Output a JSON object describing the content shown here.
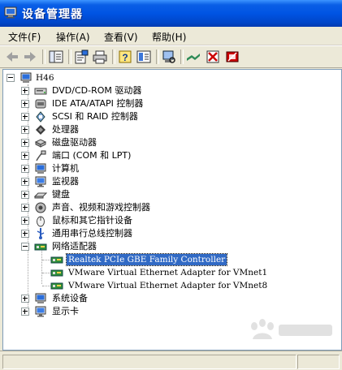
{
  "window": {
    "title": "设备管理器"
  },
  "menu": [
    {
      "label": "文件(F)"
    },
    {
      "label": "操作(A)"
    },
    {
      "label": "查看(V)"
    },
    {
      "label": "帮助(H)"
    }
  ],
  "toolbar": {
    "buttons": [
      "back-arrow-icon",
      "forward-arrow-icon",
      "show-hide-console-tree-icon",
      "properties-icon",
      "print-icon",
      "help-icon",
      "export-list-icon",
      "scan-hardware-icon",
      "update-driver-icon",
      "uninstall-icon",
      "disable-icon"
    ]
  },
  "tree": {
    "root": {
      "label": "H46",
      "icon": "computer-icon",
      "expanded": true
    },
    "items": [
      {
        "label": "DVD/CD-ROM 驱动器",
        "icon": "cdrom-icon",
        "expanded": false
      },
      {
        "label": "IDE ATA/ATAPI 控制器",
        "icon": "ide-controller-icon",
        "expanded": false
      },
      {
        "label": "SCSI 和 RAID 控制器",
        "icon": "scsi-icon",
        "expanded": false
      },
      {
        "label": "处理器",
        "icon": "processor-icon",
        "expanded": false
      },
      {
        "label": "磁盘驱动器",
        "icon": "disk-drive-icon",
        "expanded": false
      },
      {
        "label": "端口 (COM 和 LPT)",
        "icon": "port-icon",
        "expanded": false
      },
      {
        "label": "计算机",
        "icon": "computer-class-icon",
        "expanded": false
      },
      {
        "label": "监视器",
        "icon": "monitor-icon",
        "expanded": false
      },
      {
        "label": "键盘",
        "icon": "keyboard-icon",
        "expanded": false
      },
      {
        "label": "声音、视频和游戏控制器",
        "icon": "sound-icon",
        "expanded": false
      },
      {
        "label": "鼠标和其它指针设备",
        "icon": "mouse-icon",
        "expanded": false
      },
      {
        "label": "通用串行总线控制器",
        "icon": "usb-icon",
        "expanded": false
      },
      {
        "label": "网络适配器",
        "icon": "network-adapter-icon",
        "expanded": true,
        "children": [
          {
            "label": "Realtek PCIe GBE Family Controller",
            "icon": "network-card-icon",
            "selected": true
          },
          {
            "label": "VMware Virtual Ethernet Adapter for VMnet1",
            "icon": "network-card-icon",
            "selected": false
          },
          {
            "label": "VMware Virtual Ethernet Adapter for VMnet8",
            "icon": "network-card-icon",
            "selected": false
          }
        ]
      },
      {
        "label": "系统设备",
        "icon": "system-devices-icon",
        "expanded": false
      },
      {
        "label": "显示卡",
        "icon": "display-adapter-icon",
        "expanded": false
      }
    ]
  },
  "colors": {
    "titlebar": "#0054e3",
    "selection": "#316ac5",
    "chrome": "#ece9d8"
  }
}
